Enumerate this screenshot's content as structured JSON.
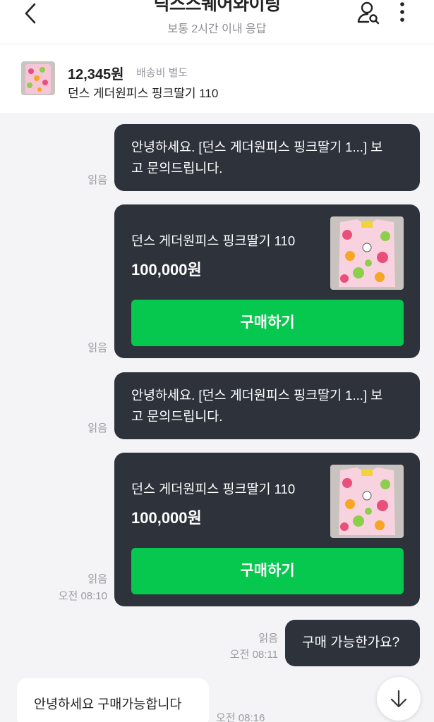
{
  "header": {
    "title": "딕스스퀘어와이팅",
    "subtitle": "보통 2시간 이내 응답"
  },
  "product": {
    "price": "12,345원",
    "shipping": "배송비 별도",
    "name": "던스 게더원피스 핑크딸기 110"
  },
  "messages": [
    {
      "type": "text",
      "line1": "안녕하세요. [던스 게더원피스 핑크딸기 1...] 보",
      "line2": "고 문의드립니다.",
      "read": "읽음"
    },
    {
      "type": "product_card",
      "name": "던스 게더원피스 핑크딸기 110",
      "price": "100,000원",
      "button": "구매하기",
      "read": "읽음"
    },
    {
      "type": "text",
      "line1": "안녕하세요. [던스 게더원피스 핑크딸기 1...] 보",
      "line2": "고 문의드립니다.",
      "read": "읽음"
    },
    {
      "type": "product_card",
      "name": "던스 게더원피스 핑크딸기 110",
      "price": "100,000원",
      "button": "구매하기",
      "read": "읽음",
      "time": "오전 08:10"
    },
    {
      "type": "text",
      "text": "구매 가능한가요?",
      "read": "읽음",
      "time": "오전 08:11"
    },
    {
      "type": "incoming",
      "text": "안녕하세요 구매가능합니다",
      "time": "오전 08:16"
    }
  ],
  "colors": {
    "bubble_dark": "#2d323b",
    "buy_button": "#07c84e",
    "background": "#f4f4f6"
  },
  "icons": {
    "back": "chevron-left-icon",
    "user": "user-search-icon",
    "more": "more-vertical-icon",
    "scroll_down": "arrow-down-icon"
  }
}
